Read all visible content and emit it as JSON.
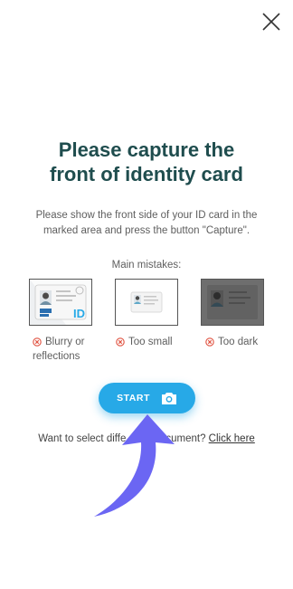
{
  "header": {
    "close_icon": "close-icon"
  },
  "title": {
    "line1": "Please capture the",
    "line2": "front of identity card"
  },
  "instructions": {
    "line1": "Please show the front side of your ID card in the",
    "line2": "marked area and press the button \"Capture\"."
  },
  "mistakes": {
    "label": "Main mistakes:",
    "items": [
      {
        "icon": "x-circle-icon",
        "line1": "Blurry or",
        "line2": "reflections"
      },
      {
        "icon": "x-circle-icon",
        "line1": "Too small",
        "line2": ""
      },
      {
        "icon": "x-circle-icon",
        "line1": "Too dark",
        "line2": ""
      }
    ],
    "thumb_card_text": "ID"
  },
  "start_button": {
    "label": "START",
    "icon": "camera-icon"
  },
  "alt_selection": {
    "prefix": "Want to select diffe",
    "hidden_middle": "rent document?",
    "suffix": "cument? ",
    "link_label": "Click here"
  },
  "colors": {
    "title": "#1f4d4e",
    "accent": "#27a9e7",
    "arrow": "#6b66f3",
    "error": "#e0513f"
  }
}
